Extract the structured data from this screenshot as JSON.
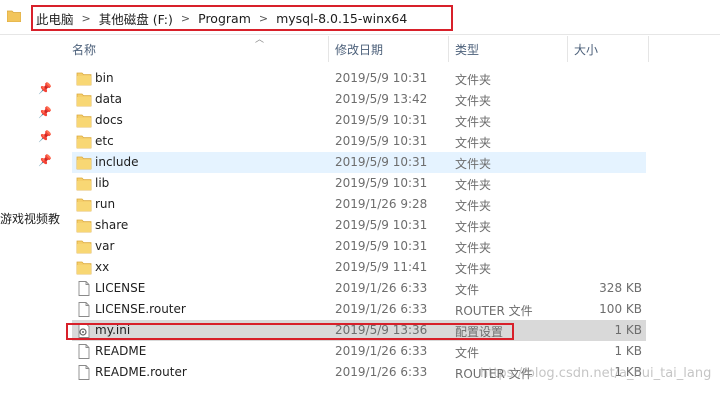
{
  "breadcrumb": [
    "此电脑",
    "其他磁盘 (F:)",
    "Program",
    "mysql-8.0.15-winx64"
  ],
  "breadcrumb_separator": ">",
  "left_pane_text": "游戏视频教",
  "columns": {
    "name": "名称",
    "date": "修改日期",
    "type": "类型",
    "size": "大小"
  },
  "files": [
    {
      "name": "bin",
      "date": "2019/5/9 10:31",
      "type": "文件夹",
      "size": "",
      "kind": "folder"
    },
    {
      "name": "data",
      "date": "2019/5/9 13:42",
      "type": "文件夹",
      "size": "",
      "kind": "folder"
    },
    {
      "name": "docs",
      "date": "2019/5/9 10:31",
      "type": "文件夹",
      "size": "",
      "kind": "folder"
    },
    {
      "name": "etc",
      "date": "2019/5/9 10:31",
      "type": "文件夹",
      "size": "",
      "kind": "folder"
    },
    {
      "name": "include",
      "date": "2019/5/9 10:31",
      "type": "文件夹",
      "size": "",
      "kind": "folder"
    },
    {
      "name": "lib",
      "date": "2019/5/9 10:31",
      "type": "文件夹",
      "size": "",
      "kind": "folder"
    },
    {
      "name": "run",
      "date": "2019/1/26 9:28",
      "type": "文件夹",
      "size": "",
      "kind": "folder"
    },
    {
      "name": "share",
      "date": "2019/5/9 10:31",
      "type": "文件夹",
      "size": "",
      "kind": "folder"
    },
    {
      "name": "var",
      "date": "2019/5/9 10:31",
      "type": "文件夹",
      "size": "",
      "kind": "folder"
    },
    {
      "name": "xx",
      "date": "2019/5/9 11:41",
      "type": "文件夹",
      "size": "",
      "kind": "folder"
    },
    {
      "name": "LICENSE",
      "date": "2019/1/26 6:33",
      "type": "文件",
      "size": "328 KB",
      "kind": "file"
    },
    {
      "name": "LICENSE.router",
      "date": "2019/1/26 6:33",
      "type": "ROUTER 文件",
      "size": "100 KB",
      "kind": "file"
    },
    {
      "name": "my.ini",
      "date": "2019/5/9 13:36",
      "type": "配置设置",
      "size": "1 KB",
      "kind": "ini"
    },
    {
      "name": "README",
      "date": "2019/1/26 6:33",
      "type": "文件",
      "size": "1 KB",
      "kind": "file"
    },
    {
      "name": "README.router",
      "date": "2019/1/26 6:33",
      "type": "ROUTER 文件",
      "size": "1 KB",
      "kind": "file"
    }
  ],
  "watermark": "https://blog.csdn.net/a_hui_tai_lang"
}
